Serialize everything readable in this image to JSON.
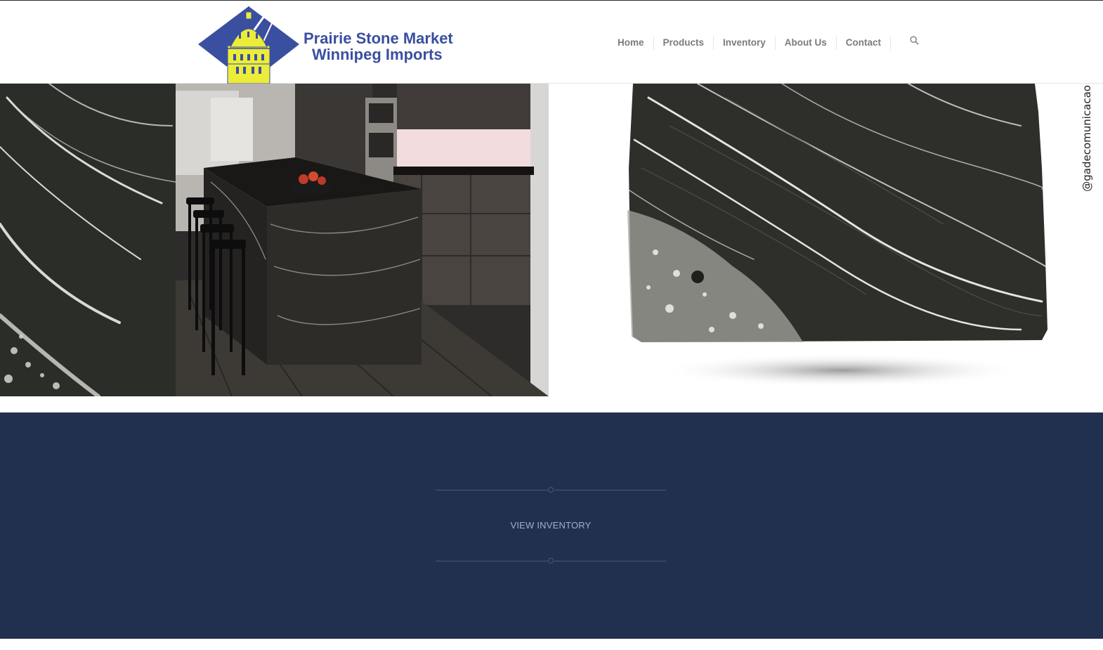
{
  "site": {
    "brand_line1": "Prairie Stone Market",
    "brand_line2": "Winnipeg Imports",
    "colors": {
      "brand_blue": "#3a4fa0",
      "logo_yellow": "#ecec3a",
      "band": "#22304f"
    }
  },
  "nav": {
    "items": [
      {
        "label": "Home"
      },
      {
        "label": "Products"
      },
      {
        "label": "Inventory"
      },
      {
        "label": "About Us"
      },
      {
        "label": "Contact"
      }
    ],
    "search_icon": "search-icon"
  },
  "hero": {
    "photo_credit": "@gadecomunicacao"
  },
  "cta": {
    "label": "VIEW INVENTORY"
  }
}
